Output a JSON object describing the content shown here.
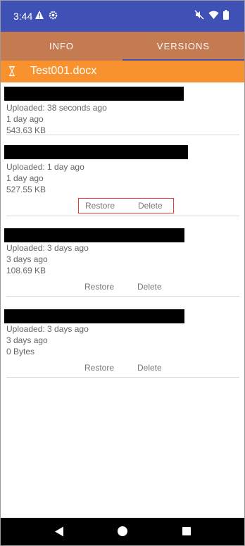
{
  "status_bar": {
    "time": "3:44",
    "left_icons": [
      "warning-icon",
      "settings-icon"
    ],
    "right_icons": [
      "mute-icon",
      "wifi-icon",
      "battery-icon"
    ]
  },
  "tabs": [
    {
      "label": "INFO",
      "active": false
    },
    {
      "label": "VERSIONS",
      "active": true
    }
  ],
  "file": {
    "icon": "hourglass-icon",
    "name": "Test001.docx"
  },
  "versions": [
    {
      "uploaded": "Uploaded: 38 seconds ago",
      "age": "1 day ago",
      "size": "543.63 KB",
      "actions": null
    },
    {
      "uploaded": "Uploaded: 1 day ago",
      "age": "1 day ago",
      "size": "527.55 KB",
      "actions": {
        "restore": "Restore",
        "delete": "Delete"
      }
    },
    {
      "uploaded": "Uploaded: 3 days ago",
      "age": "3 days ago",
      "size": "108.69 KB",
      "actions": {
        "restore": "Restore",
        "delete": "Delete"
      }
    },
    {
      "uploaded": "Uploaded: 3 days ago",
      "age": "3 days ago",
      "size": "0 Bytes",
      "actions": {
        "restore": "Restore",
        "delete": "Delete"
      }
    }
  ],
  "colors": {
    "status_bar": "#3f51b5",
    "tabs": "#c47b52",
    "file_header": "#f7922f",
    "highlight": "#e53935"
  }
}
